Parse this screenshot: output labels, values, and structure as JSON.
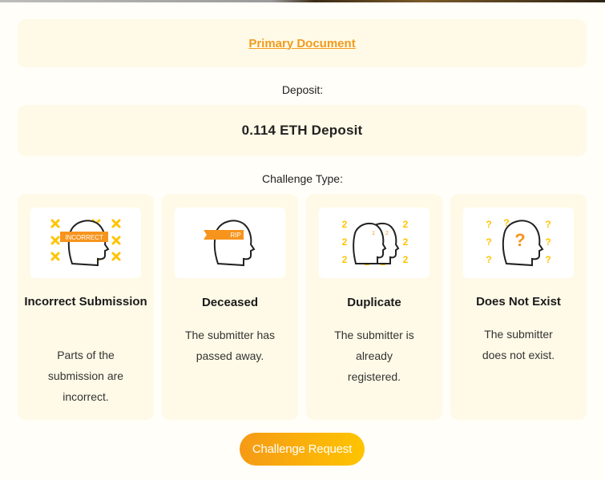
{
  "primary_document": {
    "link_text": "Primary Document"
  },
  "deposit": {
    "label": "Deposit:",
    "value": "0.114 ETH Deposit"
  },
  "challenge": {
    "label": "Challenge Type:",
    "options": [
      {
        "title": "Incorrect Submission",
        "description": "Parts of the submission are incorrect.",
        "illustration_text": "INCORRECT",
        "icon": "incorrect-icon"
      },
      {
        "title": "Deceased",
        "description": "The submitter has passed away.",
        "illustration_text": "RIP",
        "icon": "deceased-icon"
      },
      {
        "title": "Duplicate",
        "description": "The submitter is already registered.",
        "illustration_text": "2",
        "icon": "duplicate-icon"
      },
      {
        "title": "Does Not Exist",
        "description": "The submitter does not exist.",
        "illustration_text": "?",
        "icon": "does-not-exist-icon"
      }
    ]
  },
  "submit": {
    "label": "Challenge Request"
  },
  "colors": {
    "accent": "#f29b1e",
    "panel": "#fffae7",
    "marks": "#ffc400",
    "banner": "#f7941d"
  }
}
